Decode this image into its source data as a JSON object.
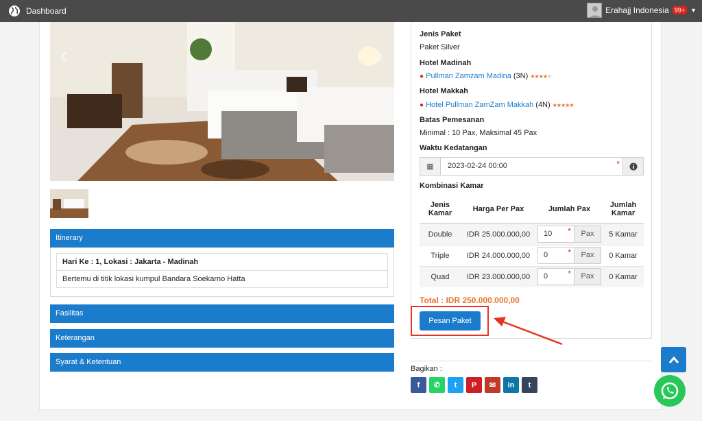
{
  "topbar": {
    "title": "Dashboard",
    "user": "Erahajj Indonesia",
    "badge": "99+"
  },
  "panels": {
    "itinerary": "Itinerary",
    "itinerary_day": "Hari Ke : 1, Lokasi : Jakarta - Madinah",
    "itinerary_desc": "Bertemu di titik lokasi kumpul Bandara Soekarno Hatta",
    "fasilitas": "Fasilitas",
    "keterangan": "Keterangan",
    "syarat": "Syarat & Ketentuan"
  },
  "package": {
    "jenis_label": "Jenis Paket",
    "jenis_value": "Paket Silver",
    "madinah_label": "Hotel Madinah",
    "madinah_hotel": "Pullman Zamzam Madina",
    "madinah_nights": "(3N)",
    "madinah_stars": 4,
    "makkah_label": "Hotel Makkah",
    "makkah_hotel": "Hotel Pullman ZamZam Makkah",
    "makkah_nights": "(4N)",
    "makkah_stars": 5,
    "batas_label": "Batas Pemesanan",
    "batas_value": "Minimal : 10 Pax, Maksimal 45 Pax",
    "waktu_label": "Waktu Kedatangan",
    "waktu_value": "2023-02-24 00:00",
    "kombinasi_label": "Kombinasi Kamar"
  },
  "rooms": {
    "headers": [
      "Jenis Kamar",
      "Harga Per Pax",
      "Jumlah Pax",
      "Jumlah Kamar"
    ],
    "unit": "Pax",
    "rows": [
      {
        "type": "Double",
        "price": "IDR 25.000.000,00",
        "pax": "10",
        "kamar": "5 Kamar"
      },
      {
        "type": "Triple",
        "price": "IDR 24.000.000,00",
        "pax": "0",
        "kamar": "0 Kamar"
      },
      {
        "type": "Quad",
        "price": "IDR 23.000.000,00",
        "pax": "0",
        "kamar": "0 Kamar"
      }
    ]
  },
  "total": "Total : IDR 250.000.000,00",
  "order_button": "Pesan Paket",
  "share": {
    "label": "Bagikan :",
    "icons": [
      {
        "name": "facebook",
        "glyph": "f",
        "color": "#3b5998"
      },
      {
        "name": "whatsapp",
        "glyph": "✆",
        "color": "#25d366"
      },
      {
        "name": "twitter",
        "glyph": "t",
        "color": "#1da1f2"
      },
      {
        "name": "pinterest",
        "glyph": "P",
        "color": "#cb2027"
      },
      {
        "name": "email",
        "glyph": "✉",
        "color": "#c0392b"
      },
      {
        "name": "linkedin",
        "glyph": "in",
        "color": "#0e76a8"
      },
      {
        "name": "tumblr",
        "glyph": "t",
        "color": "#35465c"
      }
    ]
  },
  "colors": {
    "primary": "#1c7ccc",
    "accent": "#e8732b",
    "highlight": "#e3341f"
  }
}
